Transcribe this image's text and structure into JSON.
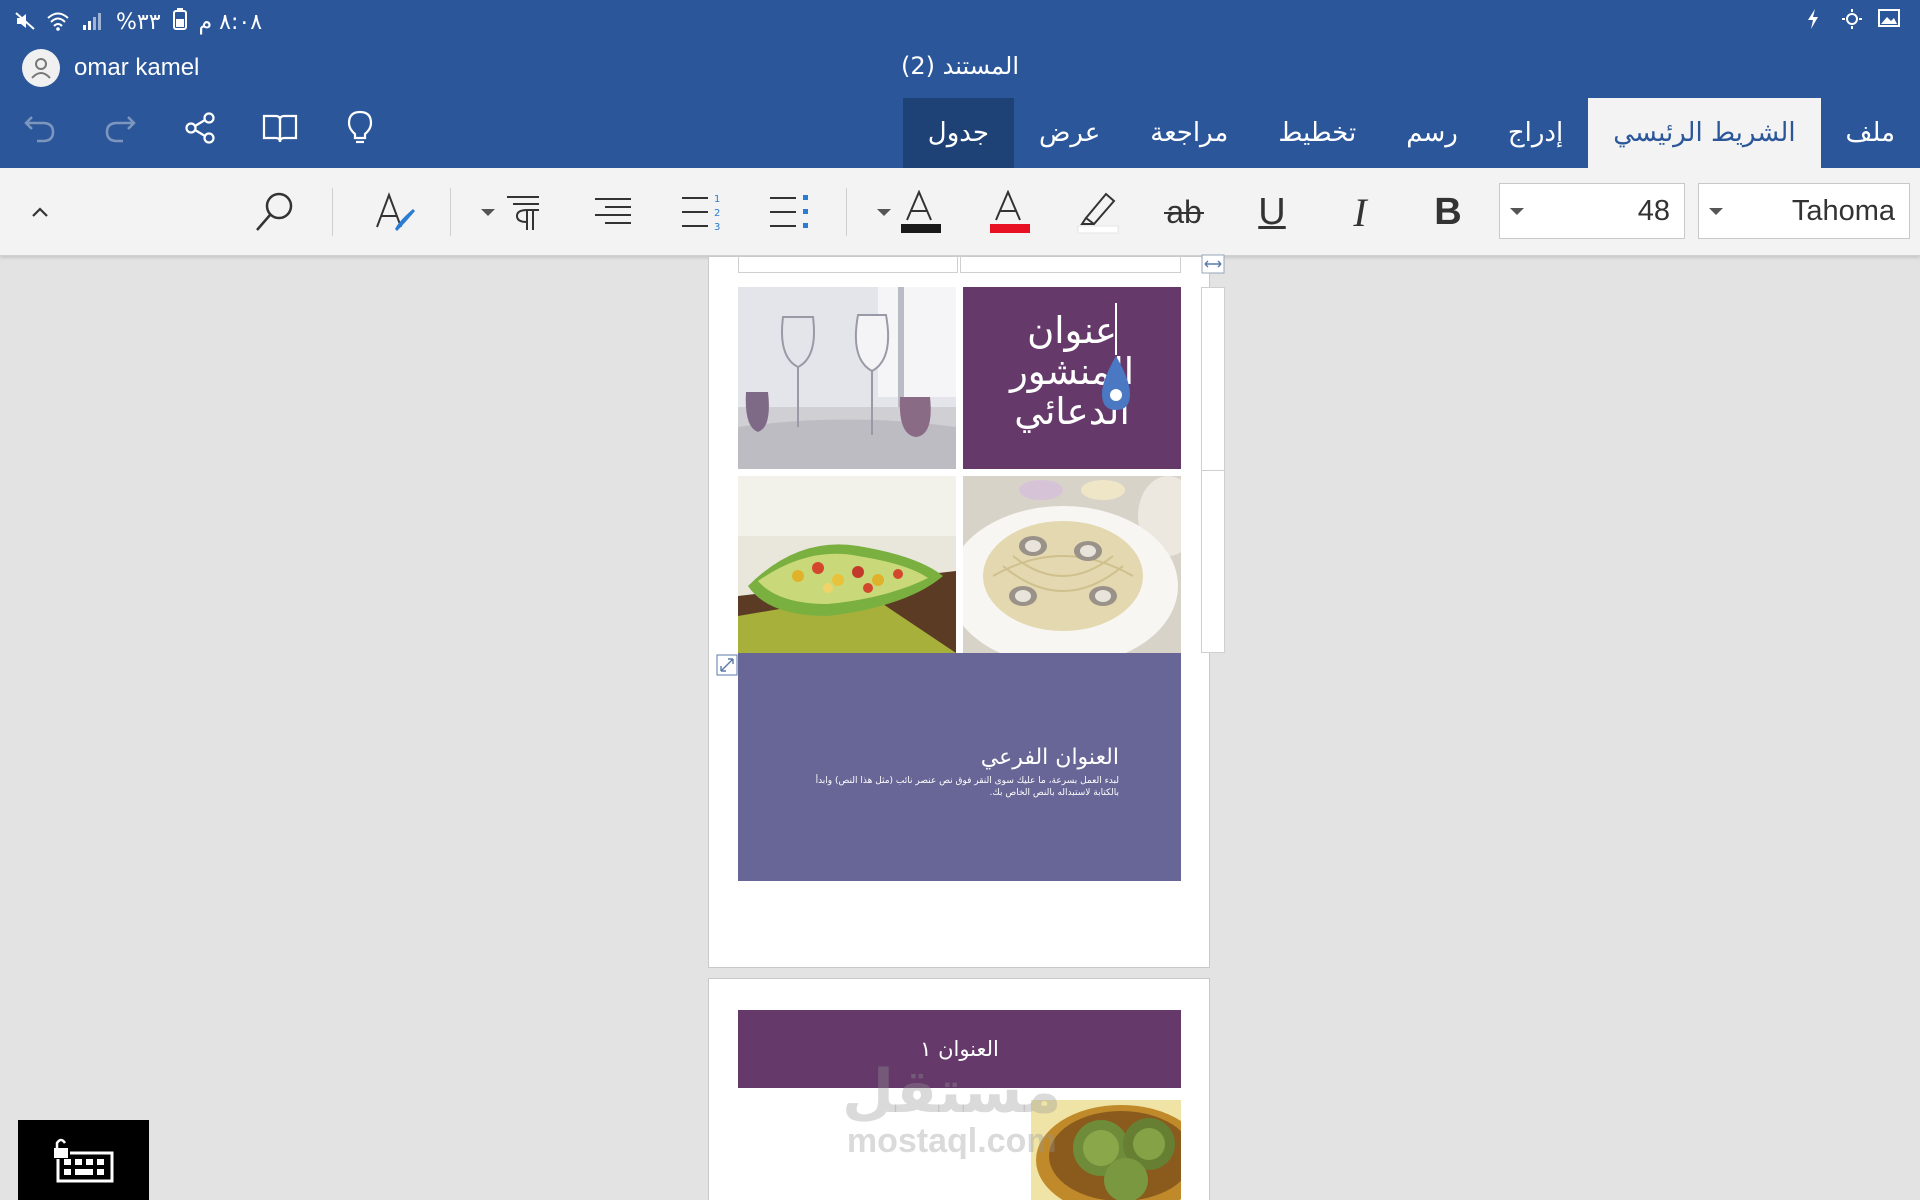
{
  "status_bar": {
    "time": "٨:٠٨ م",
    "battery": "٣٣%"
  },
  "header": {
    "user_name": "omar kamel",
    "document_title": "المستند (2)"
  },
  "tabs": [
    {
      "label": "ملف"
    },
    {
      "label": "الشريط الرئيسي"
    },
    {
      "label": "إدراج"
    },
    {
      "label": "رسم"
    },
    {
      "label": "تخطيط"
    },
    {
      "label": "مراجعة"
    },
    {
      "label": "عرض"
    },
    {
      "label": "جدول"
    }
  ],
  "ribbon": {
    "font_name": "Tahoma",
    "font_size": "48",
    "bold": "B",
    "italic": "I",
    "underline": "U",
    "strikethrough": "ab",
    "font_color_letter": "A",
    "highlight_color": "#ffffff",
    "font_color": "#e81123",
    "text_color_underline": "#1a1a1a"
  },
  "document": {
    "title_lines": [
      "عنوان",
      "المنشور",
      "الدعائي"
    ],
    "subtitle": "العنوان الفرعي",
    "body": "لبدء العمل بسرعة، ما عليك سوى النقر فوق نص عنصر نائب (مثل هذا النص) وابدأ بالكتابة لاستبداله بالنص الخاص بك.",
    "heading1": "العنوان ١"
  },
  "watermark": {
    "arabic": "مستقل",
    "latin": "mostaql.com"
  },
  "colors": {
    "app_blue": "#2b579a",
    "purple": "#653a6b",
    "slate": "#676696"
  }
}
